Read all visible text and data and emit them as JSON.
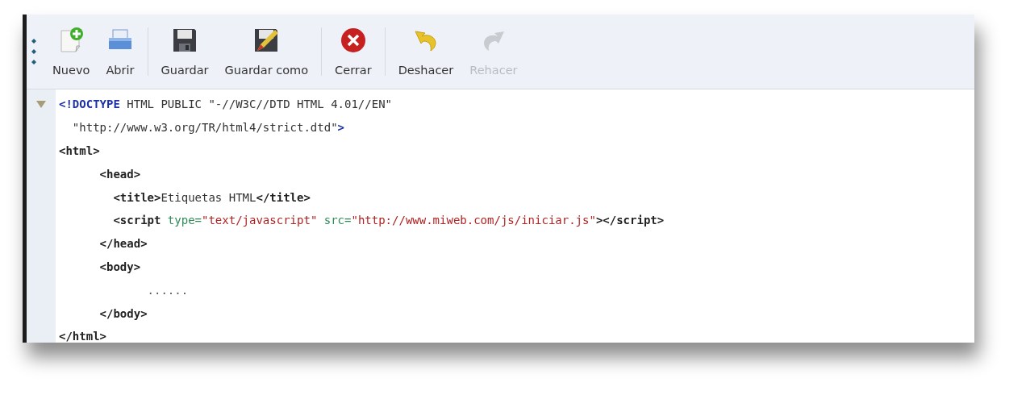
{
  "toolbar": {
    "groups": [
      [
        {
          "label": "Nuevo",
          "kind": "new",
          "disabled": false
        },
        {
          "label": "Abrir",
          "kind": "open",
          "disabled": false
        }
      ],
      [
        {
          "label": "Guardar",
          "kind": "save",
          "disabled": false
        },
        {
          "label": "Guardar como",
          "kind": "saveas",
          "disabled": false
        }
      ],
      [
        {
          "label": "Cerrar",
          "kind": "close",
          "disabled": false
        }
      ],
      [
        {
          "label": "Deshacer",
          "kind": "undo",
          "disabled": false
        },
        {
          "label": "Rehacer",
          "kind": "redo",
          "disabled": true
        }
      ]
    ]
  },
  "editor": {
    "lines": [
      {
        "fold": true,
        "tokens": [
          {
            "kind": "doctype",
            "text": "<!DOCTYPE"
          },
          {
            "kind": "text",
            "text": " HTML PUBLIC \"-//W3C//DTD HTML 4.01//EN\""
          }
        ]
      },
      {
        "fold": false,
        "tokens": [
          {
            "kind": "text",
            "text": "  \"http://www.w3.org/TR/html4/strict.dtd\""
          },
          {
            "kind": "doctype",
            "text": ">"
          }
        ]
      },
      {
        "fold": false,
        "tokens": [
          {
            "kind": "tag",
            "text": "<html>"
          }
        ]
      },
      {
        "fold": false,
        "tokens": [
          {
            "kind": "tag",
            "text": "      <head>"
          }
        ]
      },
      {
        "fold": false,
        "tokens": [
          {
            "kind": "tag",
            "text": "        <title>"
          },
          {
            "kind": "text",
            "text": "Etiquetas HTML"
          },
          {
            "kind": "tag",
            "text": "</title>"
          }
        ]
      },
      {
        "fold": false,
        "tokens": [
          {
            "kind": "tag",
            "text": "        <script"
          },
          {
            "kind": "attr",
            "text": " type="
          },
          {
            "kind": "string",
            "text": "\"text/javascript\""
          },
          {
            "kind": "attr",
            "text": " src="
          },
          {
            "kind": "string",
            "text": "\"http://www.miweb.com/js/iniciar.js\""
          },
          {
            "kind": "tag",
            "text": "></script>"
          }
        ]
      },
      {
        "fold": false,
        "tokens": [
          {
            "kind": "tag",
            "text": "      </head>"
          }
        ]
      },
      {
        "fold": false,
        "tokens": [
          {
            "kind": "tag",
            "text": "      <body>"
          }
        ]
      },
      {
        "fold": false,
        "tokens": [
          {
            "kind": "dots",
            "text": "             ......"
          }
        ]
      },
      {
        "fold": false,
        "tokens": [
          {
            "kind": "tag",
            "text": "      </body>"
          }
        ]
      },
      {
        "fold": false,
        "tokens": [
          {
            "kind": "tag",
            "text": "</html>"
          }
        ]
      }
    ]
  }
}
